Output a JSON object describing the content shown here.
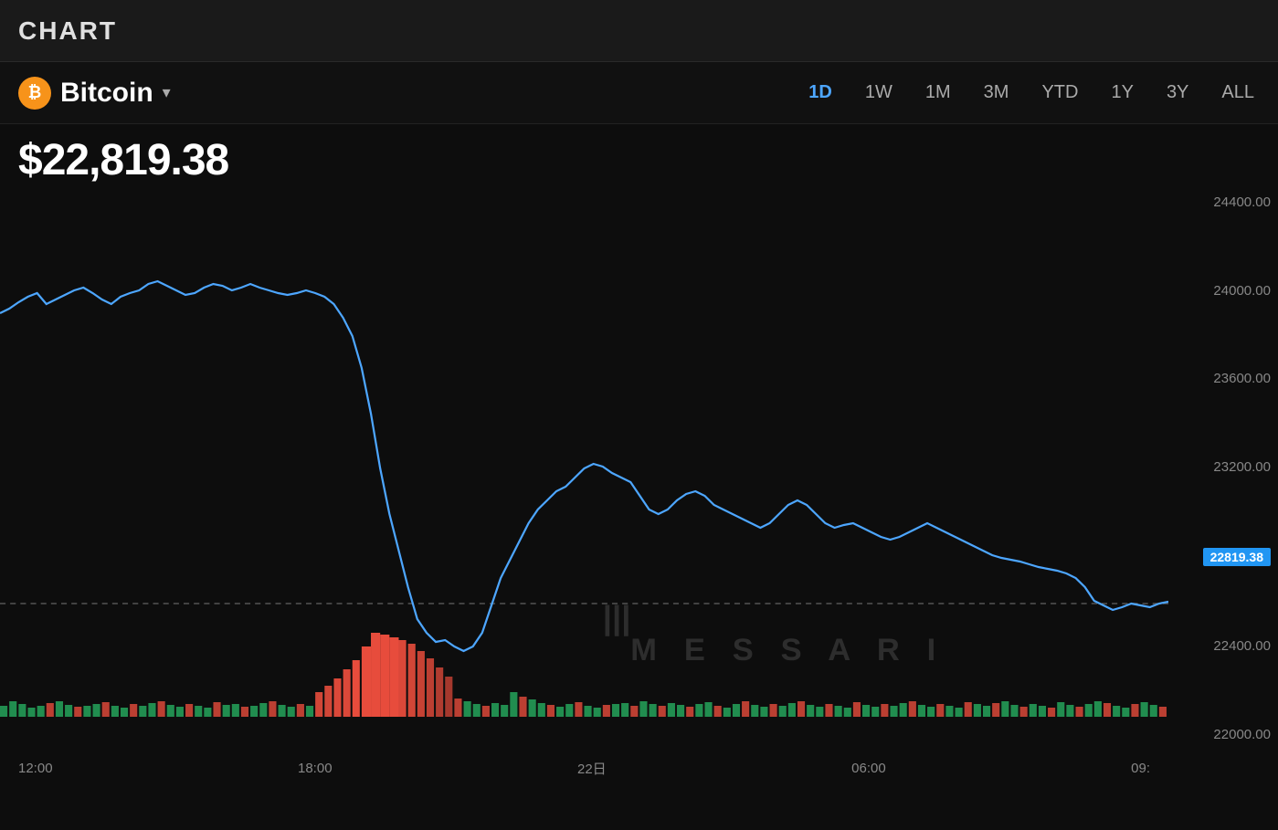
{
  "topbar": {
    "title": "CHART"
  },
  "header": {
    "coin_icon": "₿",
    "coin_name": "Bitcoin",
    "dropdown_arrow": "▾",
    "time_buttons": [
      {
        "label": "1D",
        "active": true
      },
      {
        "label": "1W",
        "active": false
      },
      {
        "label": "1M",
        "active": false
      },
      {
        "label": "3M",
        "active": false
      },
      {
        "label": "YTD",
        "active": false
      },
      {
        "label": "1Y",
        "active": false
      },
      {
        "label": "3Y",
        "active": false
      },
      {
        "label": "ALL",
        "active": false
      }
    ]
  },
  "price": {
    "current": "$22,819.38",
    "current_raw": "22819.38"
  },
  "yaxis": {
    "labels": [
      "24400.00",
      "24000.00",
      "23600.00",
      "23200.00",
      "22819.38",
      "22400.00",
      "22000.00"
    ]
  },
  "xaxis": {
    "labels": [
      "12:00",
      "18:00",
      "22日",
      "06:00",
      "09:"
    ]
  },
  "watermark": {
    "text": "M E S S A R I"
  },
  "colors": {
    "background": "#0d0d0d",
    "topbar": "#1a1a1a",
    "line": "#4da6ff",
    "current_price_badge": "#2196f3",
    "volume_up": "#e74c3c",
    "volume_down": "#27ae60",
    "accent": "#f7931a"
  }
}
